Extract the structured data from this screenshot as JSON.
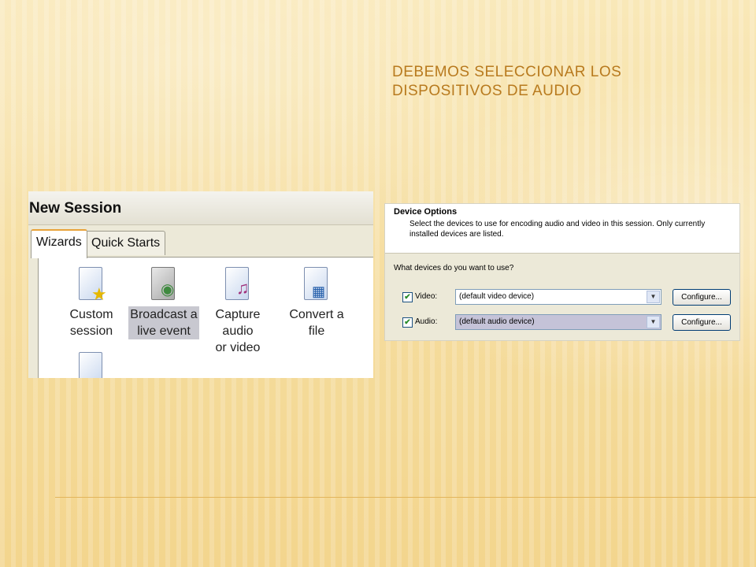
{
  "slide": {
    "title": "DEBEMOS SELECCIONAR LOS DISPOSITIVOS DE AUDIO"
  },
  "new_session": {
    "title": "New Session",
    "tabs": [
      {
        "label": "Wizards"
      },
      {
        "label": "Quick Starts"
      }
    ],
    "wizards": [
      {
        "line1": "Custom",
        "line2": "session",
        "icon": "document-star-icon"
      },
      {
        "line1": "Broadcast a",
        "line2": "live event",
        "icon": "broadcast-icon"
      },
      {
        "line1": "Capture audio",
        "line2": "or video",
        "icon": "capture-icon"
      },
      {
        "line1": "Convert a file",
        "line2": "",
        "icon": "convert-icon"
      }
    ]
  },
  "device_options": {
    "heading": "Device Options",
    "description": "Select the devices to use for encoding audio and video in this session. Only currently installed devices are listed.",
    "question": "What devices do you want to use?",
    "video": {
      "label": "Video:",
      "value": "(default video device)",
      "configure": "Configure..."
    },
    "audio": {
      "label": "Audio:",
      "value": "(default audio device)",
      "configure": "Configure..."
    }
  }
}
